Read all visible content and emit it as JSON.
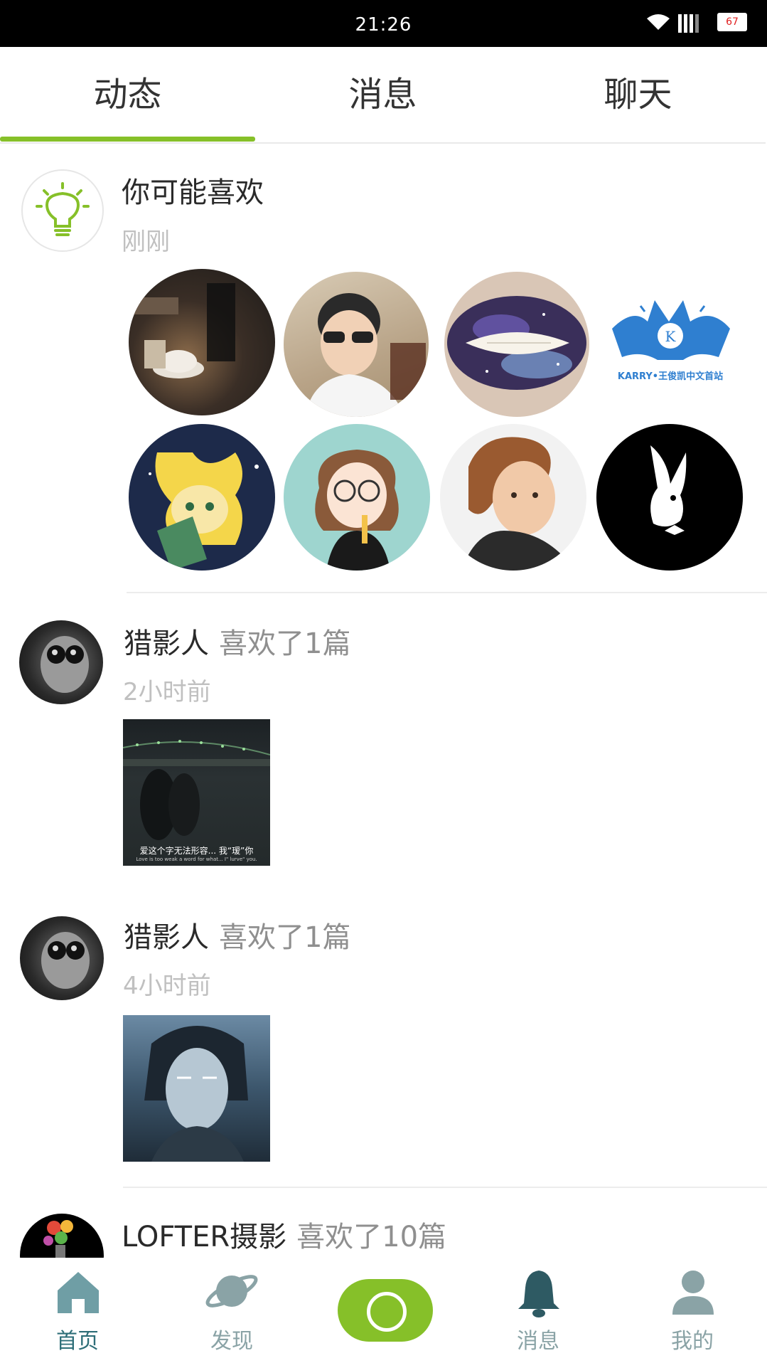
{
  "status_bar": {
    "time": "21:26",
    "battery": "67"
  },
  "tabs": [
    {
      "label": "动态",
      "active": true
    },
    {
      "label": "消息",
      "active": false
    },
    {
      "label": "聊天",
      "active": false
    }
  ],
  "colors": {
    "accent": "#86c029",
    "nav_active": "#2e6e78",
    "nav_inactive": "#8aa3a6"
  },
  "recommend": {
    "icon": "lightbulb-icon",
    "title": "你可能喜欢",
    "time": "刚刚",
    "avatars": [
      "coffee-shop-photo",
      "boy-sunglasses-photo",
      "galaxy-lips-photo",
      "karry-logo",
      "loki-cartoon",
      "glasses-girl-cartoon",
      "painted-woman-portrait",
      "playboy-bunny-logo"
    ],
    "logo_text": "KARRY•王俊凯中文首站"
  },
  "feed": [
    {
      "user": "猎影人",
      "action": "喜欢了1篇",
      "time": "2小时前",
      "thumb_caption_cn": "爱这个字无法形容... 我“瑷”你",
      "thumb_caption_en": "Love is too weak a word for what... I\" lurve\" you."
    },
    {
      "user": "猎影人",
      "action": "喜欢了1篇",
      "time": "4小时前"
    },
    {
      "user": "LOFTER摄影",
      "action": "喜欢了10篇"
    }
  ],
  "bottom_nav": [
    {
      "label": "首页",
      "icon": "home-icon",
      "active": true
    },
    {
      "label": "发现",
      "icon": "planet-icon",
      "active": false
    },
    {
      "label": "",
      "icon": "publish-icon",
      "active": false
    },
    {
      "label": "消息",
      "icon": "bell-icon",
      "active": false
    },
    {
      "label": "我的",
      "icon": "user-icon",
      "active": false
    }
  ]
}
